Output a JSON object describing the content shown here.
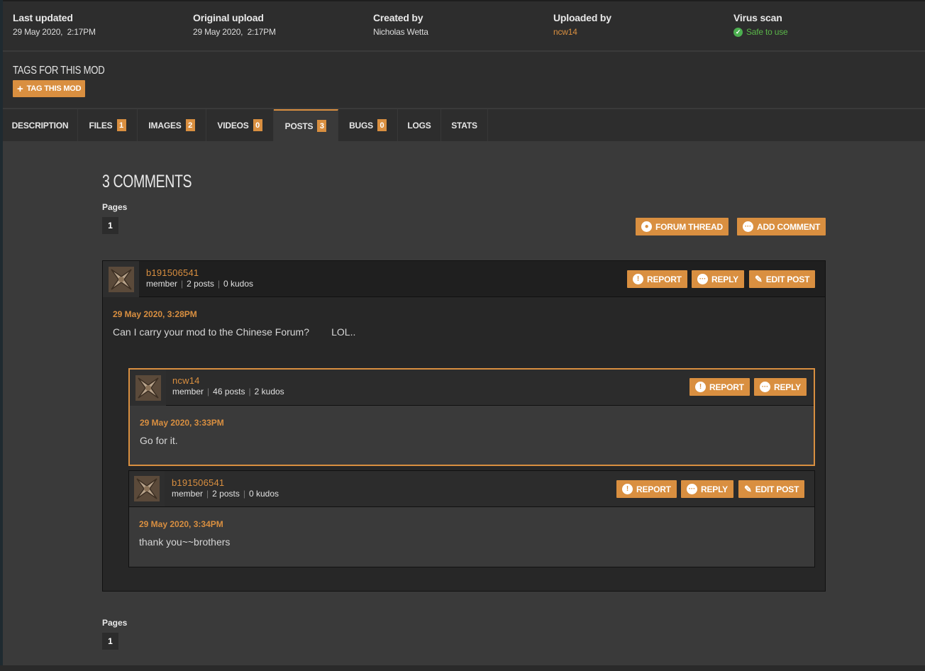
{
  "stats": [
    {
      "title": "Last updated",
      "value": "29 May 2020,  2:17PM"
    },
    {
      "title": "Original upload",
      "value": "29 May 2020,  2:17PM"
    },
    {
      "title": "Created by",
      "value": "Nicholas Wetta"
    },
    {
      "title": "Uploaded by",
      "value": "ncw14"
    },
    {
      "title": "Virus scan",
      "value": "Safe to use"
    }
  ],
  "tags": {
    "title": "TAGS FOR THIS MOD",
    "button": "TAG THIS MOD"
  },
  "tabs": [
    {
      "label": "DESCRIPTION"
    },
    {
      "label": "FILES",
      "count": "1"
    },
    {
      "label": "IMAGES",
      "count": "2"
    },
    {
      "label": "VIDEOS",
      "count": "0"
    },
    {
      "label": "POSTS",
      "count": "3"
    },
    {
      "label": "BUGS",
      "count": "0"
    },
    {
      "label": "LOGS"
    },
    {
      "label": "STATS"
    }
  ],
  "comments": {
    "title": "3 COMMENTS",
    "pages_label": "Pages",
    "page_number": "1",
    "forum_thread": "FORUM THREAD",
    "add_comment": "ADD COMMENT"
  },
  "actions": {
    "report": "REPORT",
    "reply": "REPLY",
    "edit": "EDIT POST"
  },
  "posts": [
    {
      "user": "b191506541",
      "role": "member",
      "posts": "2 posts",
      "kudos": "0 kudos",
      "date": "29 May 2020, 3:28PM",
      "text": "Can I carry your mod to the Chinese Forum?        LOL.."
    },
    {
      "user": "ncw14",
      "role": "member",
      "posts": "46 posts",
      "kudos": "2 kudos",
      "date": "29 May 2020, 3:33PM",
      "text": "Go for it."
    },
    {
      "user": "b191506541",
      "role": "member",
      "posts": "2 posts",
      "kudos": "0 kudos",
      "date": "29 May 2020, 3:34PM",
      "text": "thank you~~brothers"
    }
  ],
  "colors": {
    "accent": "#d98f40",
    "safe": "#5ab649",
    "background": "#3a3a3a",
    "panel": "#2d2d2d"
  }
}
